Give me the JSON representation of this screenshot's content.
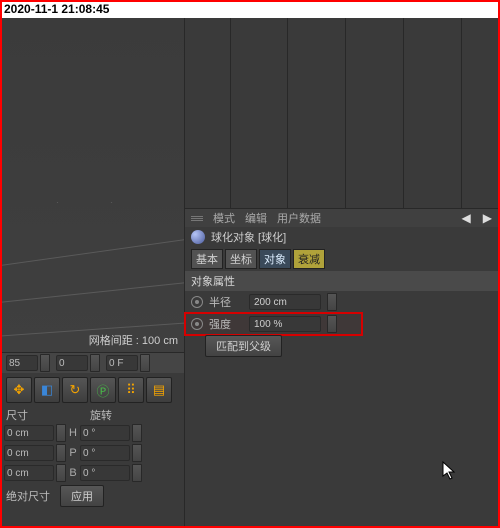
{
  "timestamp": "2020-11-1 21:08:45",
  "viewport": {
    "status": "网格间距 : 100 cm"
  },
  "coord_bar": {
    "val1": "85",
    "val2": "0",
    "val3": "0 F"
  },
  "toolbar": {
    "move_glyph": "✥",
    "cube_glyph": "◧",
    "rotate_glyph": "↻",
    "p_glyph": "Ⓟ",
    "dots_glyph": "⠿",
    "film_glyph": "▤"
  },
  "headers": {
    "size": "尺寸",
    "rotate": "旋转"
  },
  "xform": [
    {
      "v1": "0 cm",
      "l": "H",
      "v2": "0 °"
    },
    {
      "v1": "0 cm",
      "l": "P",
      "v2": "0 °"
    },
    {
      "v1": "0 cm",
      "l": "B",
      "v2": "0 °"
    }
  ],
  "footer": {
    "label": "绝对尺寸",
    "apply": "应用"
  },
  "menu": {
    "mode": "模式",
    "edit": "编辑",
    "userdata": "用户数据"
  },
  "nav": {
    "left": "◀",
    "right": "▶"
  },
  "object": {
    "title": "球化对象 [球化]"
  },
  "ptabs": {
    "basic": "基本",
    "coord": "坐标",
    "object": "对象",
    "decay": "衰减"
  },
  "section": {
    "title": "对象属性"
  },
  "props": {
    "radius_label": "半径",
    "radius_value": "200 cm",
    "strength_label": "强度",
    "strength_value": "100 %"
  },
  "buttons": {
    "fit": "匹配到父级"
  }
}
